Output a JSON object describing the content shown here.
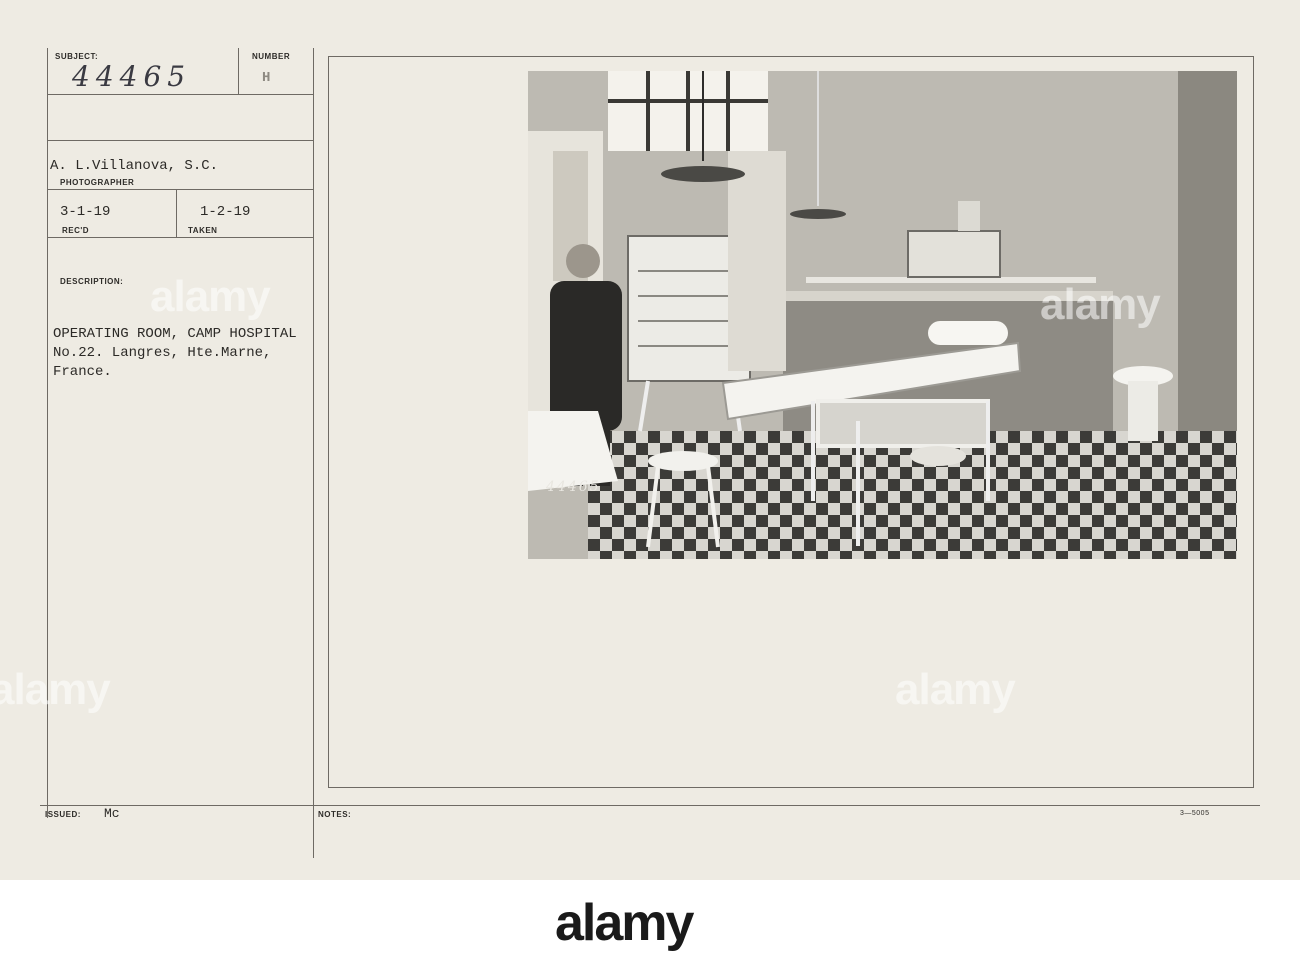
{
  "card": {
    "subject_label": "SUBJECT:",
    "subject_number": "44465",
    "number_label": "NUMBER",
    "number_value": "H",
    "photographer_name": "A. L.Villanova, S.C.",
    "photographer_label": "PHOTOGRAPHER",
    "received_date": "3-1-19",
    "received_label": "REC'D",
    "taken_date": "1-2-19",
    "taken_label": "TAKEN",
    "description_label": "DESCRIPTION:",
    "description_lines": [
      "OPERATING ROOM, CAMP HOSPITAL",
      "No.22. Langres, Hte.Marne,",
      "France."
    ],
    "issued_label": "ISSUED:",
    "issued_value": "Mc",
    "notes_label": "NOTES:",
    "form_number": "3—5005"
  },
  "photo": {
    "inscribed_number": "44465"
  },
  "watermark": {
    "text": "alamy"
  },
  "footer": {
    "logo_text": "alamy"
  }
}
